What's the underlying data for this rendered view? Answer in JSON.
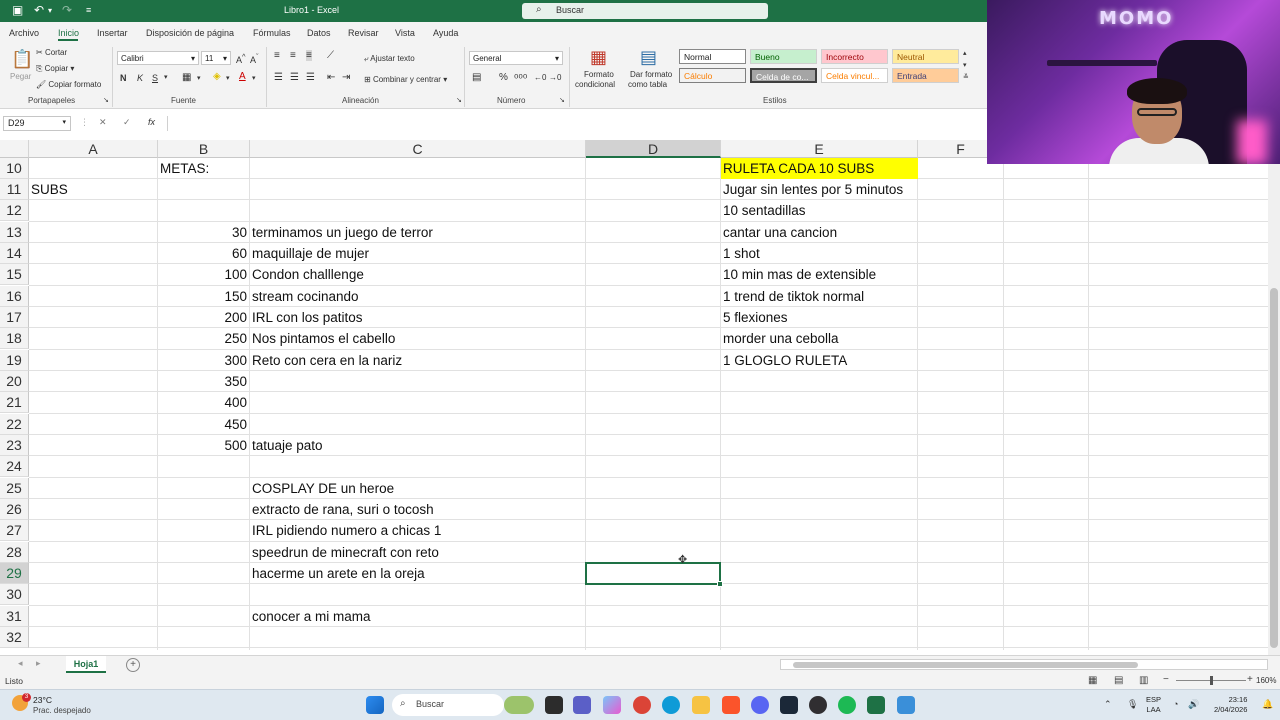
{
  "titlebar": {
    "title": "Libro1 - Excel",
    "search_placeholder": "Buscar"
  },
  "menu_tabs": [
    "Archivo",
    "Inicio",
    "Insertar",
    "Disposición de página",
    "Fórmulas",
    "Datos",
    "Revisar",
    "Vista",
    "Ayuda"
  ],
  "ribbon": {
    "clipboard": {
      "paste": "Pegar",
      "cut": "Cortar",
      "copy": "Copiar",
      "format_painter": "Copiar formato",
      "group": "Portapapeles"
    },
    "font": {
      "name": "Calibri",
      "size": "11",
      "bold": "N",
      "italic": "K",
      "underline": "S",
      "group": "Fuente"
    },
    "alignment": {
      "wrap": "Ajustar texto",
      "merge": "Combinar y centrar",
      "group": "Alineación"
    },
    "number": {
      "format": "General",
      "group": "Número"
    },
    "cond_format": {
      "line1": "Formato",
      "line2": "condicional"
    },
    "table_format": {
      "line1": "Dar formato",
      "line2": "como tabla"
    },
    "styles": {
      "group": "Estilos",
      "items": [
        "Normal",
        "Bueno",
        "Incorrecto",
        "Neutral",
        "Cálculo",
        "Celda de co...",
        "Celda vincul...",
        "Entrada"
      ]
    }
  },
  "formula_bar": {
    "name_box": "D29",
    "cancel": "✕",
    "enter": "✓",
    "fx": "fx",
    "value": ""
  },
  "columns": [
    "A",
    "B",
    "C",
    "D",
    "E",
    "F"
  ],
  "rows": [
    "10",
    "11",
    "12",
    "13",
    "14",
    "15",
    "16",
    "17",
    "18",
    "19",
    "20",
    "21",
    "22",
    "23",
    "24",
    "25",
    "26",
    "27",
    "28",
    "29",
    "30",
    "31",
    "32"
  ],
  "cells": {
    "B10": "METAS:",
    "A11": "SUBS",
    "E10": "RULETA CADA 10 SUBS",
    "E11": "Jugar sin lentes por 5 minutos",
    "E12": "10 sentadillas",
    "E13": "cantar una cancion",
    "E14": "1 shot",
    "E15": "10 min mas de extensible",
    "E16": "1 trend de tiktok normal",
    "E17": "5 flexiones",
    "E18": "morder una cebolla",
    "E19": "1 GLOGLO RULETA",
    "B13": "30",
    "C13": "terminamos un juego de terror",
    "B14": "60",
    "C14": "maquillaje de mujer",
    "B15": "100",
    "C15": "Condon challlenge",
    "B16": "150",
    "C16": "stream cocinando",
    "B17": "200",
    "C17": "IRL con los patitos",
    "B18": "250",
    "C18": "Nos pintamos el cabello",
    "B19": "300",
    "C19": "Reto con cera en la nariz",
    "B20": "350",
    "B21": "400",
    "B22": "450",
    "B23": "500",
    "C23": "tatuaje pato",
    "C25": "COSPLAY DE un heroe",
    "C26": "extracto de rana, suri o tocosh",
    "C27": "IRL pidiendo numero a chicas 1",
    "C28": "speedrun de minecraft con reto",
    "C29": "hacerme un arete en la oreja",
    "C31": "conocer a mi mama"
  },
  "highlight_color": "#ffff00",
  "accent_color": "#1e7145",
  "sheet_tab": "Hoja1",
  "status": {
    "ready": "Listo",
    "zoom": "160%"
  },
  "taskbar": {
    "temperature": "23°C",
    "condition": "Prac. despejado",
    "weather_badge": "3",
    "search": "Buscar",
    "lang1": "ESP",
    "lang2": "LAA",
    "time": "23:16",
    "date": "2/04/2026"
  },
  "webcam": {
    "sign_text": "MOMO"
  }
}
